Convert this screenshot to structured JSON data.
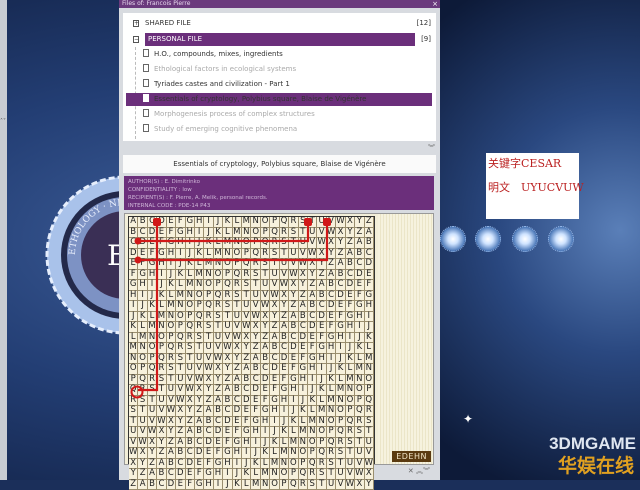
{
  "window": {
    "title": "Files of: Francois Pierre",
    "close": "×"
  },
  "tree": {
    "shared": {
      "label": "SHARED FILE",
      "count": "[12]",
      "toggle": "+"
    },
    "personal": {
      "label": "PERSONAL FILE",
      "count": "[9]",
      "toggle": "−"
    },
    "docs": [
      {
        "label": "H.O., compounds, mixes, ingredients"
      },
      {
        "label": "Ethological factors in ecological systems"
      },
      {
        "label": "Tyriades castes and civilization - Part 1"
      },
      {
        "label": "Essentials of cryptology, Polybius square, Blaise de Vigénère"
      },
      {
        "label": "Morphogenesis process of complex structures"
      },
      {
        "label": "Study of emerging cognitive phenomena"
      }
    ],
    "collapse": "︾"
  },
  "document": {
    "title": "Essentials of cryptology, Polybius square, Blaise de Vigénère",
    "author": "AUTHOR(S) : E. Dimitrinko",
    "confidentiality": "CONFIDENTIALITY : low",
    "recipients": "RECIPIENT(S) : F. Pierre, A. Melik, personal records.",
    "code": "INTERNAL CODE : PDE-14 P43",
    "alphabet": "ABCDEFGHIJKLMNOPQRSTUVWXYZ",
    "key_label": "EDEHN",
    "bottom_icons": "✕ ︽︾"
  },
  "note": {
    "line1": "关键字CESAR",
    "line2": "明文　UYUCVUW"
  },
  "watermark": {
    "brand": "3DMGAME",
    "cn": "华娱在线"
  },
  "seal": {
    "text": "ETHOLOGY · NEUROSCIENCE"
  },
  "side": {
    "arrows": "˄˅"
  }
}
